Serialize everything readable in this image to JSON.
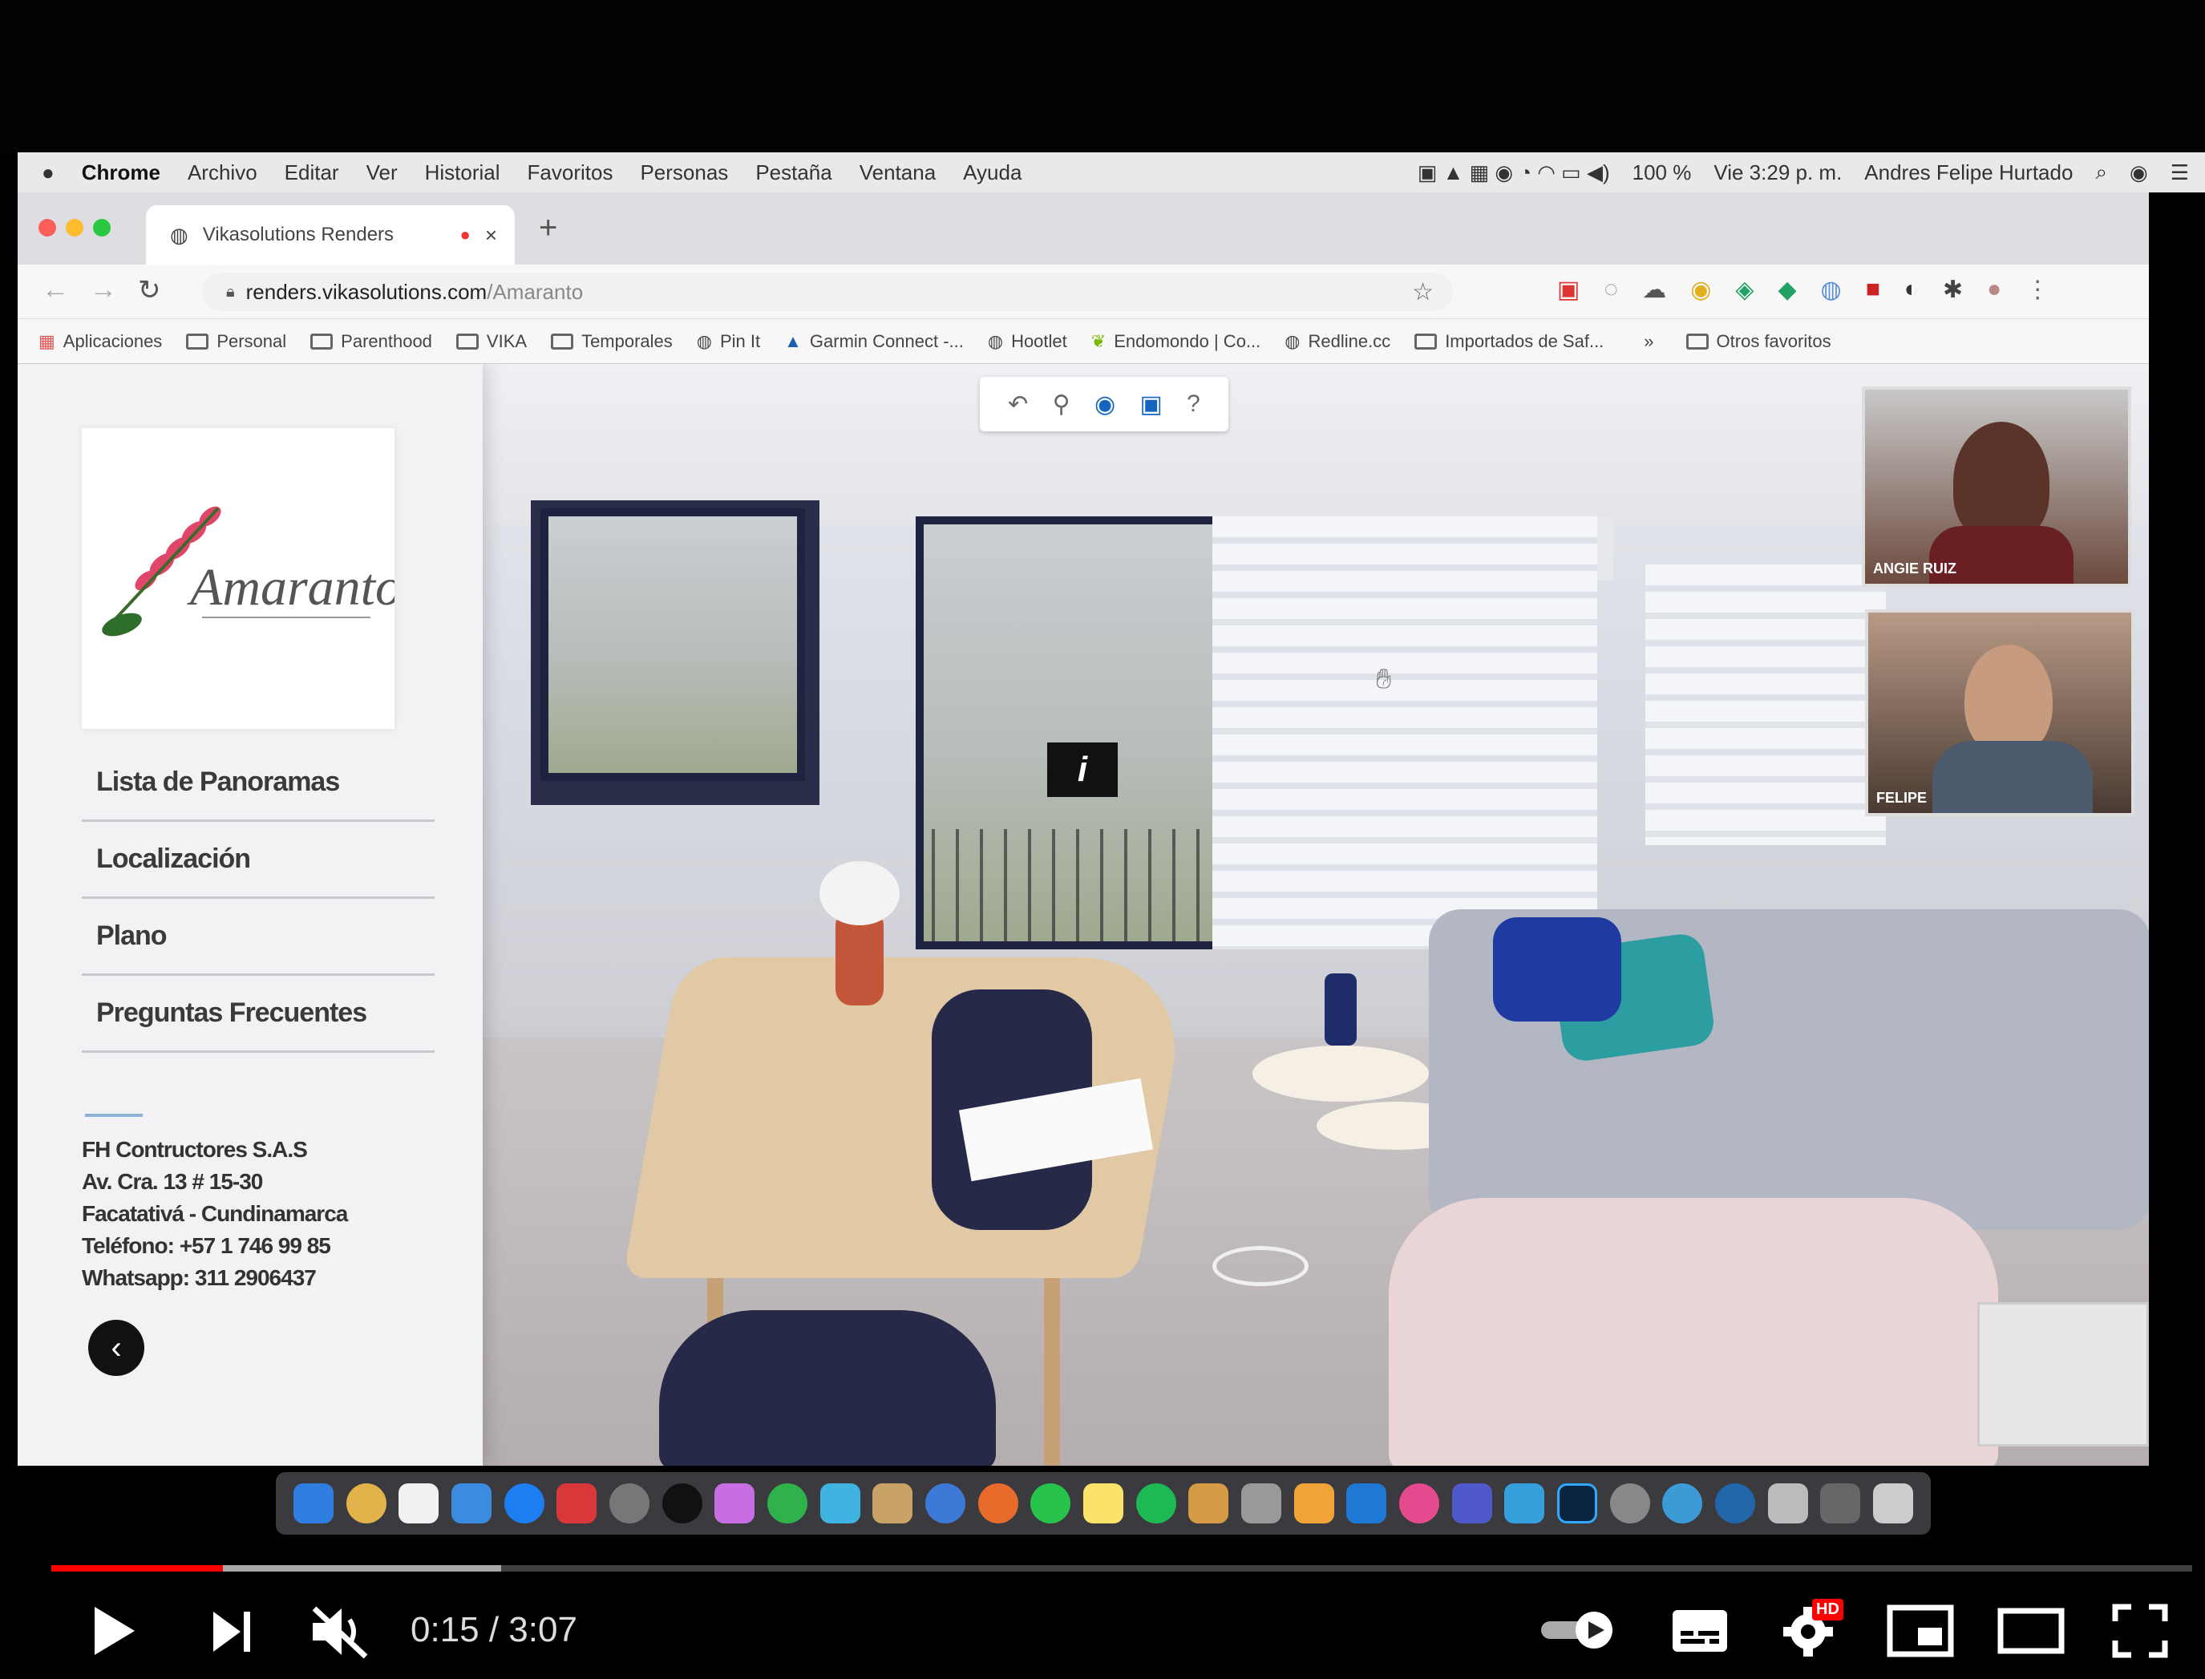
{
  "mac_menubar": {
    "app": "Chrome",
    "menus": [
      "Archivo",
      "Editar",
      "Ver",
      "Historial",
      "Favoritos",
      "Personas",
      "Pestaña",
      "Ventana",
      "Ayuda"
    ],
    "battery": "100 %",
    "clock": "Vie 3:29 p. m.",
    "user": "Andres Felipe Hurtado"
  },
  "browser": {
    "tab_title": "Vikasolutions Renders",
    "new_tab": "+",
    "url_host": "renders.vikasolutions.com",
    "url_path": "/Amaranto",
    "bookmarks": [
      "Aplicaciones",
      "Personal",
      "Parenthood",
      "VIKA",
      "Temporales",
      "Pin It",
      "Garmin Connect -...",
      "Hootlet",
      "Endomondo | Co...",
      "Redline.cc",
      "Importados de Saf..."
    ],
    "other_bookmarks": "Otros favoritos"
  },
  "sidebar": {
    "logo_text": "Amaranto",
    "menu": [
      "Lista de Panoramas",
      "Localización",
      "Plano",
      "Preguntas Frecuentes"
    ],
    "company": [
      "FH Contructores S.A.S",
      "Av. Cra. 13 # 15-30",
      "Facatativá - Cundinamarca",
      "Teléfono: +57 1 746 99 85",
      "Whatsapp: 311 2906437"
    ]
  },
  "pano_toolbar": {
    "help": "?"
  },
  "hotspot": {
    "info": "i"
  },
  "video_call": {
    "tiles": [
      "ANGIE RUIZ",
      "FELIPE"
    ]
  },
  "player": {
    "time": "0:15 / 3:07",
    "progress_played": 0.08,
    "progress_buffered": 0.21,
    "hd_badge": "HD"
  },
  "colors": {
    "progress": "#ff0000",
    "logo_pink": "#e0456a"
  }
}
